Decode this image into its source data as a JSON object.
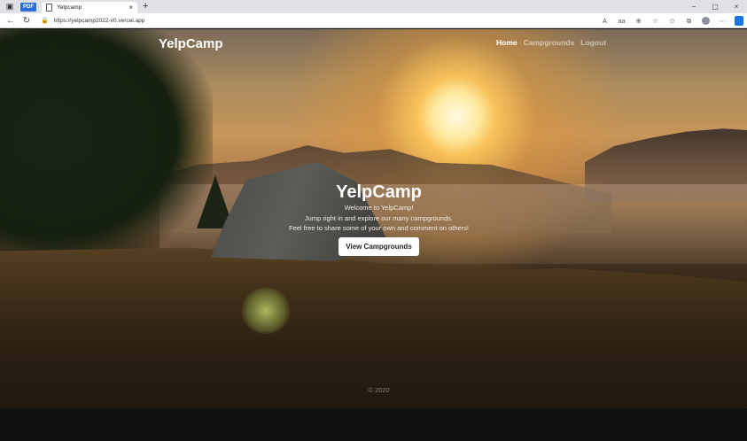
{
  "browser": {
    "pdf_badge": "PDF",
    "tab_title": "Yelpcamp",
    "tab_close": "×",
    "new_tab": "+",
    "url": "https://yelpcamp2022-v0.vercel.app",
    "window_controls": [
      "−",
      "▢",
      "×"
    ],
    "toolbar_icons": [
      "A",
      "aa",
      "zoom-icon",
      "favorite-icon",
      "favorites-list-icon",
      "collections-icon",
      "profile-icon",
      "more-icon"
    ]
  },
  "navbar": {
    "brand": "YelpCamp",
    "links": [
      {
        "label": "Home",
        "active": true
      },
      {
        "label": "Campgrounds",
        "active": false
      },
      {
        "label": "Logout",
        "active": false
      }
    ]
  },
  "hero": {
    "title": "YelpCamp",
    "lines": [
      "Welcome to YelpCamp!",
      "Jump right in and explore our many campgrounds.",
      "Feel free to share some of your own and comment on others!"
    ],
    "button": "View Campgrounds"
  },
  "footer": {
    "text": "© 2020"
  },
  "colors": {
    "accent_button_bg": "#ffffff",
    "footer_bg": "#111111"
  }
}
